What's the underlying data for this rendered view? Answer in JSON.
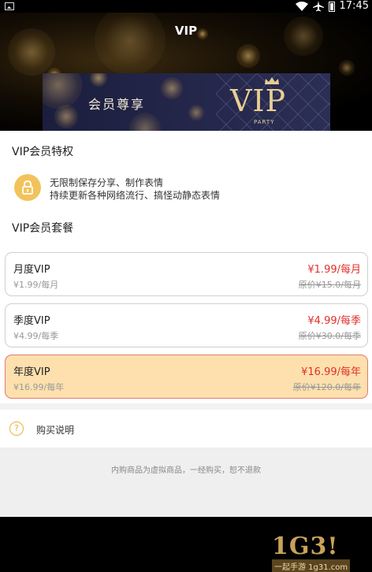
{
  "status_bar": {
    "time": "17:45"
  },
  "header": {
    "title": "VIP",
    "banner": {
      "text": "会员尊享",
      "logo": "VIP",
      "sub": "PARTY"
    }
  },
  "privileges": {
    "title": "VIP会员特权",
    "icon": "lock-icon",
    "lines": [
      "无限制保存分享、制作表情",
      "持续更新各种网络流行、搞怪动静态表情"
    ]
  },
  "packages": {
    "title": "VIP会员套餐",
    "items": [
      {
        "name": "月度VIP",
        "price": "¥1.99/每月",
        "sub": "¥1.99/每月",
        "original": "原价¥15.0/每月",
        "selected": false
      },
      {
        "name": "季度VIP",
        "price": "¥4.99/每季",
        "sub": "¥4.99/每季",
        "original": "原价¥30.0/每季",
        "selected": false
      },
      {
        "name": "年度VIP",
        "price": "¥16.99/每年",
        "sub": "¥16.99/每年",
        "original": "原价¥120.0/每年",
        "selected": true
      }
    ]
  },
  "help": {
    "icon": "question-icon",
    "text": "购买说明"
  },
  "notice": "内购商品为虚拟商品，一经购买，恕不退款",
  "watermark": {
    "logo": "1G3!",
    "text": "一起手游 1g31.com"
  },
  "colors": {
    "price": "#e0302b",
    "selected_bg": "#fde0ae",
    "selected_border": "#e07a6e",
    "accent": "#f2c35b"
  }
}
